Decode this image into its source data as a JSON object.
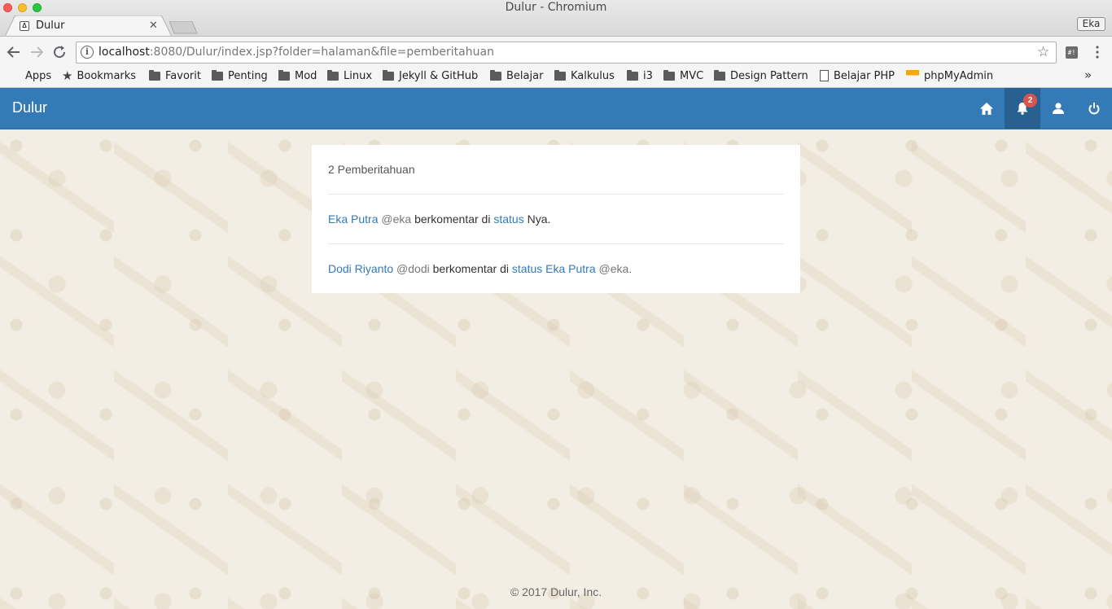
{
  "window": {
    "title": "Dulur - Chromium",
    "profile": "Eka"
  },
  "tab": {
    "title": "Dulur"
  },
  "omnibox": {
    "host": "localhost",
    "rest": ":8080/Dulur/index.jsp?folder=halaman&file=pemberitahuan"
  },
  "bookmarks": [
    {
      "label": "Apps",
      "icon": "apps-icon"
    },
    {
      "label": "Bookmarks",
      "icon": "star-icon"
    },
    {
      "label": "Favorit",
      "icon": "folder-icon"
    },
    {
      "label": "Penting",
      "icon": "folder-icon"
    },
    {
      "label": "Mod",
      "icon": "folder-icon"
    },
    {
      "label": "Linux",
      "icon": "folder-icon"
    },
    {
      "label": "Jekyll & GitHub",
      "icon": "folder-icon"
    },
    {
      "label": "Belajar",
      "icon": "folder-icon"
    },
    {
      "label": "Kalkulus",
      "icon": "folder-icon"
    },
    {
      "label": "i3",
      "icon": "folder-icon"
    },
    {
      "label": "MVC",
      "icon": "folder-icon"
    },
    {
      "label": "Design Pattern",
      "icon": "folder-icon"
    },
    {
      "label": "Belajar PHP",
      "icon": "page-icon"
    },
    {
      "label": "phpMyAdmin",
      "icon": "pma-icon"
    }
  ],
  "navbar": {
    "brand": "Dulur",
    "notification_count": "2",
    "icons": [
      "home-icon",
      "bell-icon",
      "user-icon",
      "power-icon"
    ]
  },
  "notifications": {
    "header": "2 Pemberitahuan",
    "items": [
      {
        "user": "Eka Putra",
        "handle": "@eka",
        "verb": "berkomentar di",
        "object": "status",
        "suffix": "Nya."
      },
      {
        "user": "Dodi Riyanto",
        "handle": "@dodi",
        "verb": "berkomentar di",
        "object": "status",
        "target_user": "Eka Putra",
        "target_handle": "@eka."
      }
    ]
  },
  "footer": {
    "text": "© 2017 Dulur, Inc."
  },
  "colors": {
    "navbar": "#337ab7",
    "navbar_active": "#286090",
    "link": "#337ab7",
    "badge": "#d9534f",
    "background": "#f3eee3"
  }
}
